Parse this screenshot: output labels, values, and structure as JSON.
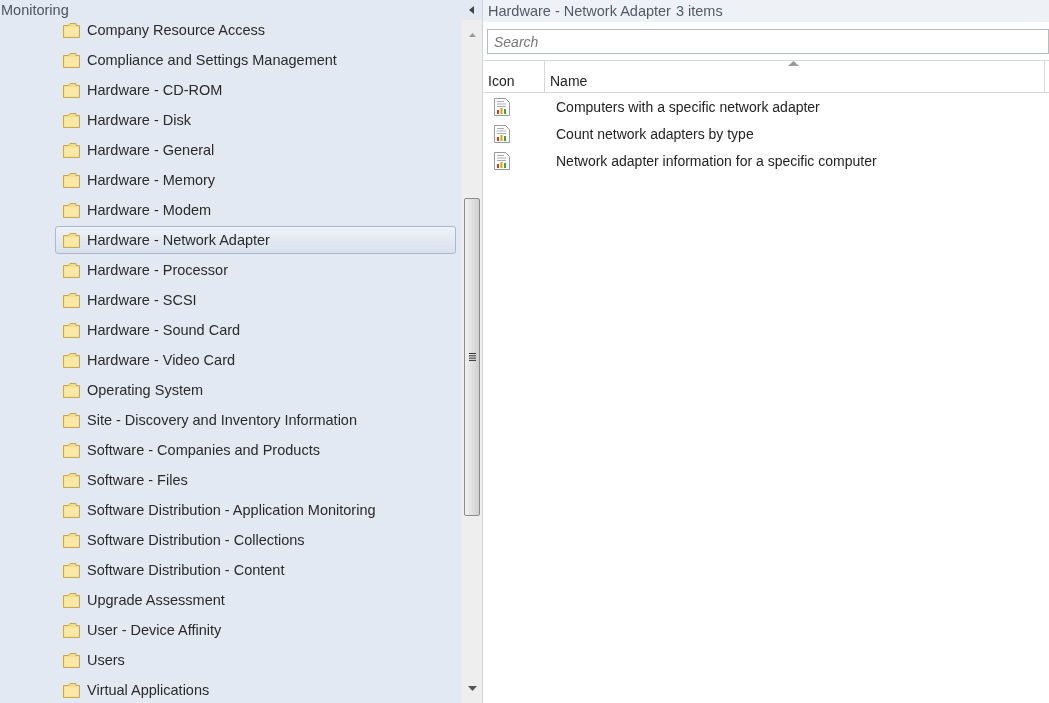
{
  "navigation_pane": {
    "title": "Monitoring",
    "folders": [
      {
        "label": "Company Resource Access",
        "selected": false
      },
      {
        "label": "Compliance and Settings Management",
        "selected": false
      },
      {
        "label": "Hardware - CD-ROM",
        "selected": false
      },
      {
        "label": "Hardware - Disk",
        "selected": false
      },
      {
        "label": "Hardware - General",
        "selected": false
      },
      {
        "label": "Hardware - Memory",
        "selected": false
      },
      {
        "label": "Hardware - Modem",
        "selected": false
      },
      {
        "label": "Hardware - Network Adapter",
        "selected": true
      },
      {
        "label": "Hardware - Processor",
        "selected": false
      },
      {
        "label": "Hardware - SCSI",
        "selected": false
      },
      {
        "label": "Hardware - Sound Card",
        "selected": false
      },
      {
        "label": "Hardware - Video Card",
        "selected": false
      },
      {
        "label": "Operating System",
        "selected": false
      },
      {
        "label": "Site - Discovery and Inventory Information",
        "selected": false
      },
      {
        "label": "Software - Companies and Products",
        "selected": false
      },
      {
        "label": "Software - Files",
        "selected": false
      },
      {
        "label": "Software Distribution - Application Monitoring",
        "selected": false
      },
      {
        "label": "Software Distribution - Collections",
        "selected": false
      },
      {
        "label": "Software Distribution - Content",
        "selected": false
      },
      {
        "label": "Upgrade Assessment",
        "selected": false
      },
      {
        "label": "User - Device Affinity",
        "selected": false
      },
      {
        "label": "Users",
        "selected": false
      },
      {
        "label": "Virtual Applications",
        "selected": false
      }
    ]
  },
  "content_pane": {
    "title": "Hardware - Network Adapter",
    "count": "3 items",
    "search": {
      "placeholder": "Search"
    },
    "table": {
      "columns": [
        "Icon",
        "Name"
      ],
      "rows": [
        {
          "name": "Computers with a specific network adapter"
        },
        {
          "name": "Count network adapters by type"
        },
        {
          "name": "Network adapter information for a specific computer"
        }
      ]
    }
  }
}
